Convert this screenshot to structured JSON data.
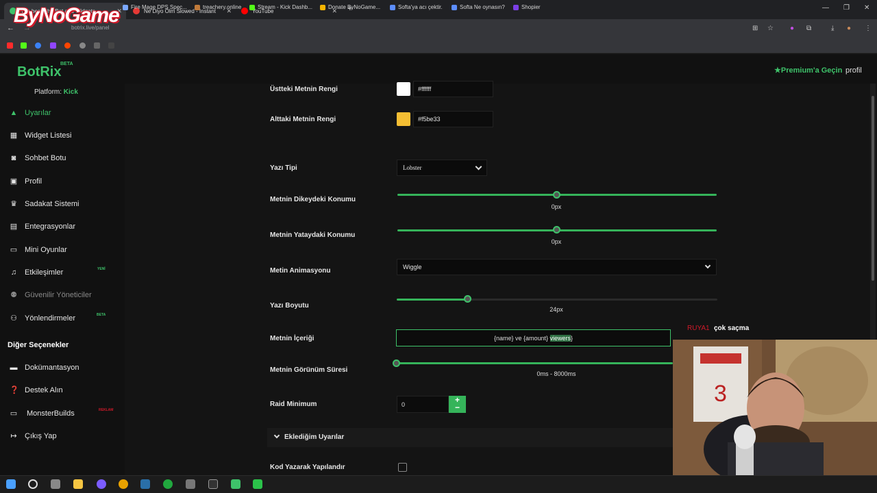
{
  "browser": {
    "tabs": [
      {
        "title": "The best ChatBot and Widgets...",
        "icon": "botrix-tab-icon",
        "color": "#3ec26a"
      },
      {
        "title": "Ne Diyo Olm Slowed - Instant",
        "icon": "sound-tab-icon",
        "color": "#e53935"
      },
      {
        "title": "YouTube",
        "icon": "youtube-tab-icon",
        "color": "#ff0000"
      }
    ],
    "url": "botrix.live/panel",
    "bookmarks": [
      {
        "label": "Fire Mage DPS Spec...",
        "color": "#7aa7ff"
      },
      {
        "label": "treachery.online",
        "color": "#c07a3a"
      },
      {
        "label": "Stream - Kick Dashb...",
        "color": "#53fc18"
      },
      {
        "label": "Donate ByNoGame...",
        "color": "#f5b400"
      },
      {
        "label": "Softa'ya acı çektir.",
        "color": "#5c8dff"
      },
      {
        "label": "Softa Ne oynasın?",
        "color": "#5c8dff"
      },
      {
        "label": "Shopier",
        "color": "#7b3fe4"
      }
    ]
  },
  "overlay": {
    "logo": "ByNoGame"
  },
  "app": {
    "brand": "BotRix",
    "beta": "BETA",
    "premium": "Premium'a Geçin",
    "profile": "profil",
    "platform_label": "Platform:",
    "platform_value": "Kick"
  },
  "sidebar": {
    "items": [
      {
        "label": "Uyarılar",
        "icon": "warning-icon"
      },
      {
        "label": "Widget Listesi",
        "icon": "grid-icon"
      },
      {
        "label": "Sohbet Botu",
        "icon": "robot-icon"
      },
      {
        "label": "Profil",
        "icon": "profile-card-icon"
      },
      {
        "label": "Sadakat Sistemi",
        "icon": "trophy-icon"
      },
      {
        "label": "Entegrasyonlar",
        "icon": "integration-icon"
      },
      {
        "label": "Mini Oyunlar",
        "icon": "gamepad-icon"
      },
      {
        "label": "Etkileşimler",
        "icon": "music-note-icon",
        "badge": "YENİ"
      },
      {
        "label": "Güvenilir Yöneticiler",
        "icon": "users-icon"
      },
      {
        "label": "Yönlendirmeler",
        "icon": "people-icon",
        "badge": "BETA"
      }
    ],
    "other_heading": "Diğer Seçenekler",
    "other_items": [
      {
        "label": "Dokümantasyon",
        "icon": "document-icon"
      },
      {
        "label": "Destek Alın",
        "icon": "question-icon"
      },
      {
        "label": "MonsterBuilds",
        "icon": "monitor-icon",
        "badge": "REKLAM"
      },
      {
        "label": "Çıkış Yap",
        "icon": "logout-icon"
      }
    ]
  },
  "form": {
    "top_color_label": "Üstteki Metnin Rengi",
    "top_color_value": "#ffffff",
    "bottom_color_label": "Alttaki Metnin Rengi",
    "bottom_color_value": "#f5be33",
    "font_label": "Yazı Tipi",
    "font_value": "Lobster",
    "vertical_label": "Metnin Dikeydeki Konumu",
    "vertical_value": "0px",
    "horizontal_label": "Metnin Yataydaki Konumu",
    "horizontal_value": "0px",
    "animation_label": "Metin Animasyonu",
    "animation_value": "Wiggle",
    "size_label": "Yazı Boyutu",
    "size_value": "24px",
    "size_fraction": 0.22,
    "content_label": "Metnin İçeriği",
    "content_prefix": "{name} ve {amount} ",
    "content_selected": "viewers",
    "content_suffix": "}",
    "duration_label": "Metnin Görünüm Süresi",
    "duration_value": "0ms - 8000ms",
    "raid_label": "Raid Minimum",
    "raid_value": "0",
    "my_alerts_label": "Eklediğim Uyarılar",
    "code_label": "Kod Yazarak Yapılandır"
  },
  "chat": {
    "user": "RUYA1",
    "message": "çok saçma"
  }
}
